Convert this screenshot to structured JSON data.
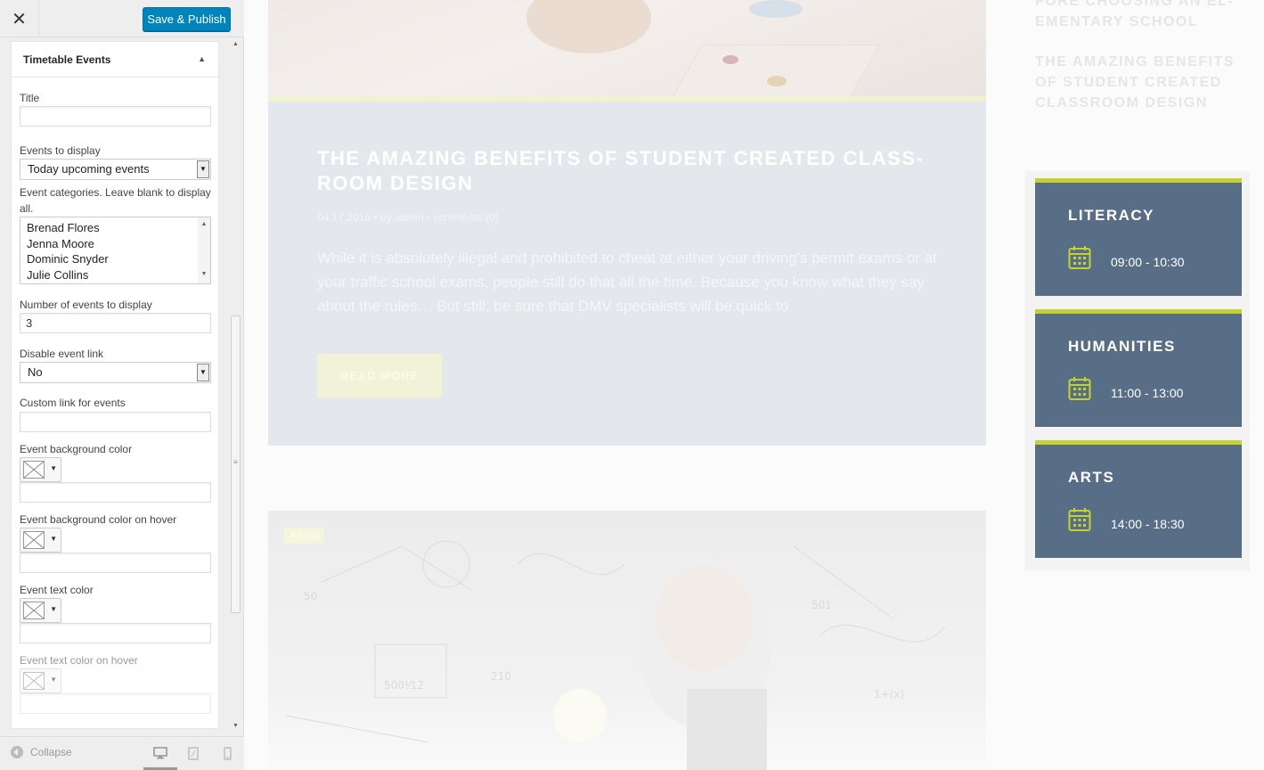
{
  "sidebar": {
    "save_label": "Save & Publish",
    "widget_title": "Timetable Events",
    "fields": {
      "title_label": "Title",
      "title_value": "",
      "events_to_display_label": "Events to display",
      "events_to_display_value": "Today upcoming events",
      "categories_label": "Event categories. Leave blank to display all.",
      "categories_options": [
        "Brenad Flores",
        "Jenna Moore",
        "Dominic Snyder",
        "Julie Collins"
      ],
      "number_label": "Number of events to display",
      "number_value": "3",
      "disable_link_label": "Disable event link",
      "disable_link_value": "No",
      "custom_link_label": "Custom link for events",
      "custom_link_value": "",
      "bg_color_label": "Event background color",
      "bg_hover_label": "Event background color on hover",
      "text_color_label": "Event text color",
      "text_hover_label": "Event text color on hover"
    },
    "footer": {
      "collapse_label": "Collapse"
    }
  },
  "preview": {
    "post": {
      "title": "THE AMAZING BENEFITS OF STUDENT CREATED CLASS-ROOM DESIGN",
      "meta": "04.17.2016  •  by admin  •  comments (0)",
      "excerpt": "While it is absolutely illegal and prohibited to cheat at either your driving's permit exams or at your traffic school exams, people still do that all the time. Because you know what they say about the rules… But still, be sure that DMV specialists will be quick to",
      "read_more": "READ MORE"
    },
    "post2_badge": "Article",
    "side_links": [
      "FORE CHOOSING AN EL-EMENTARY SCHOOL",
      "THE AMAZING BENEFITS OF STUDENT CREATED CLASSROOM DESIGN"
    ],
    "timetable": [
      {
        "name": "LITERACY",
        "time": "09:00 - 10:30"
      },
      {
        "name": "HUMANITIES",
        "time": "11:00 - 13:00"
      },
      {
        "name": "ARTS",
        "time": "14:00 - 18:30"
      }
    ]
  },
  "colors": {
    "primary_button": "#0085ba",
    "card_bg": "#586e86",
    "card_accent": "#c4d22f"
  },
  "icons": [
    "close-icon",
    "calendar-icon",
    "desktop-icon",
    "tablet-icon",
    "mobile-icon",
    "collapse-icon",
    "triangle-up-icon",
    "chevron-down-icon"
  ]
}
